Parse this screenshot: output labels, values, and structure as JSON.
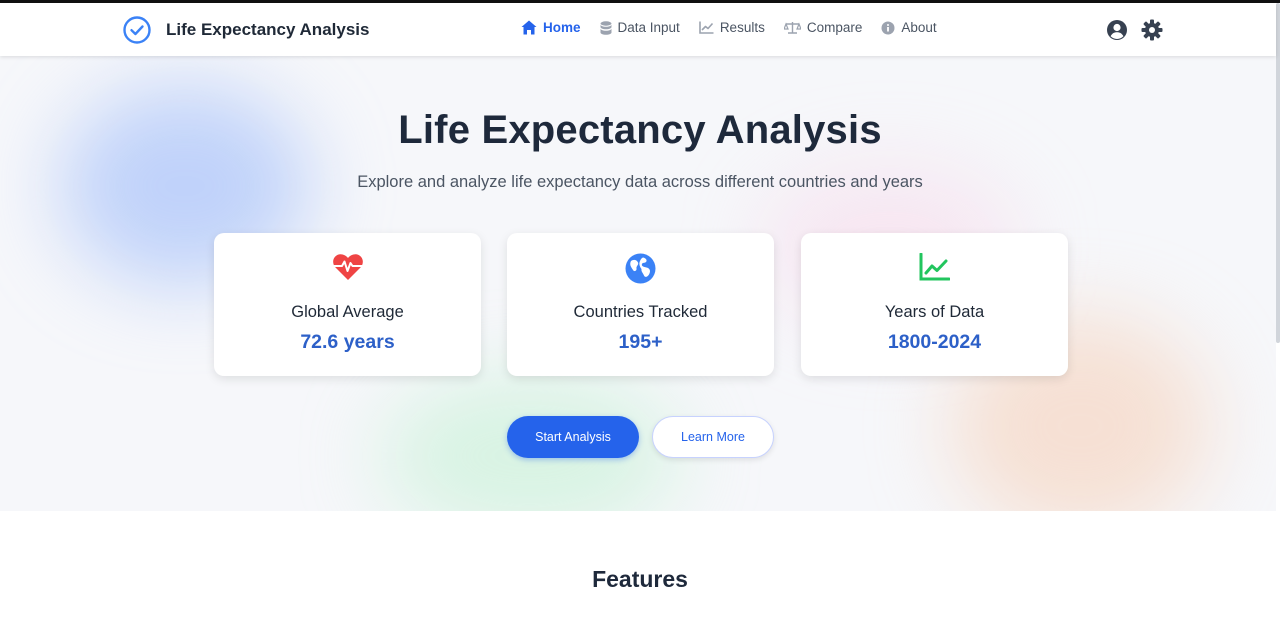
{
  "brand": {
    "name": "Life Expectancy Analysis",
    "logo_icon": "check-circle-icon"
  },
  "nav": {
    "links": [
      {
        "label": "Home",
        "icon": "home-icon",
        "active": true
      },
      {
        "label": "Data Input",
        "icon": "database-icon",
        "active": false
      },
      {
        "label": "Results",
        "icon": "line-chart-icon",
        "active": false
      },
      {
        "label": "Compare",
        "icon": "balance-scale-icon",
        "active": false
      },
      {
        "label": "About",
        "icon": "info-circle-icon",
        "active": false
      }
    ],
    "actions": [
      {
        "icon": "user-circle-icon"
      },
      {
        "icon": "gear-icon"
      }
    ]
  },
  "hero": {
    "title": "Life Expectancy Analysis",
    "subtitle": "Explore and analyze life expectancy data across different countries and years",
    "stats": [
      {
        "icon": "heartbeat-icon",
        "label": "Global Average",
        "value": "72.6 years",
        "icon_color": "#ef4444"
      },
      {
        "icon": "globe-icon",
        "label": "Countries Tracked",
        "value": "195+",
        "icon_color": "#3b82f6"
      },
      {
        "icon": "chart-line-icon",
        "label": "Years of Data",
        "value": "1800-2024",
        "icon_color": "#22c55e"
      }
    ],
    "primary_button": "Start Analysis",
    "secondary_button": "Learn More"
  },
  "features": {
    "title": "Features"
  },
  "colors": {
    "accent": "#2563eb",
    "value_text": "#2d60c8",
    "title_text": "#1e293b"
  }
}
